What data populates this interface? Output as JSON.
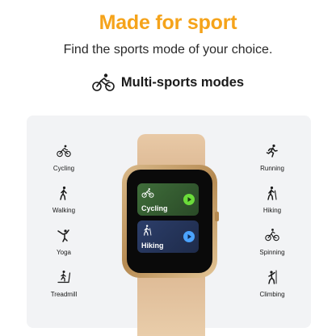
{
  "headline": "Made for sport",
  "subline": "Find the sports mode of your choice.",
  "section": {
    "title": "Multi-sports modes",
    "icon": "cyclist-icon"
  },
  "left_modes": [
    {
      "label": "Cycling",
      "icon": "cycling-icon"
    },
    {
      "label": "Walking",
      "icon": "walking-icon"
    },
    {
      "label": "Yoga",
      "icon": "yoga-icon"
    },
    {
      "label": "Treadmill",
      "icon": "treadmill-icon"
    }
  ],
  "right_modes": [
    {
      "label": "Running",
      "icon": "running-icon"
    },
    {
      "label": "Hiking",
      "icon": "hiking-icon"
    },
    {
      "label": "Spinning",
      "icon": "spinning-icon"
    },
    {
      "label": "Climbing",
      "icon": "climbing-icon"
    }
  ],
  "watch": {
    "cards": [
      {
        "label": "Cycling",
        "color": "#6bdc3a"
      },
      {
        "label": "Hiking",
        "color": "#4ba3ff"
      }
    ],
    "band_color": "#e2c19d",
    "case_color": "#c9a46e"
  },
  "colors": {
    "headline": "#f5a31a",
    "panel": "#f2f3f5"
  }
}
